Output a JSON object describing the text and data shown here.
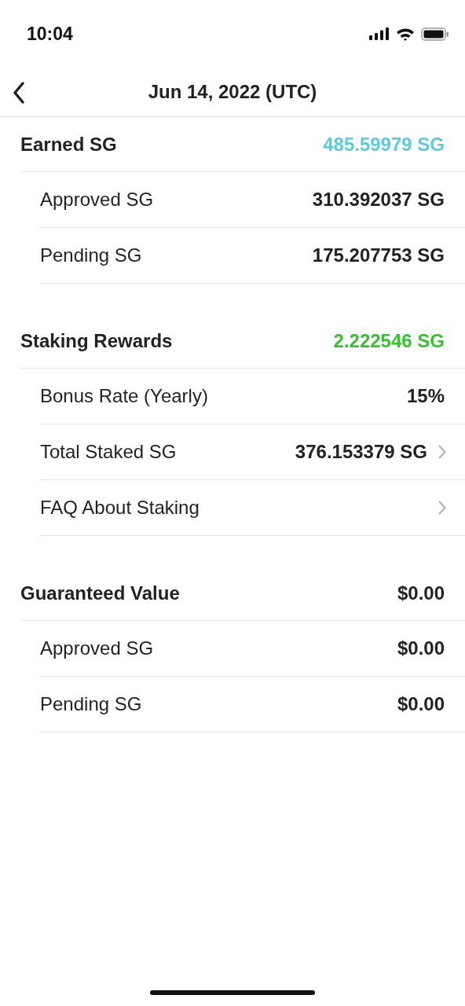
{
  "status_bar": {
    "time": "10:04"
  },
  "nav": {
    "title": "Jun 14, 2022 (UTC)"
  },
  "sections": [
    {
      "title": "Earned SG",
      "value": "485.59979 SG",
      "color": "#58cbdc",
      "rows": [
        {
          "label": "Approved SG",
          "value": "310.392037 SG",
          "chevron": false
        },
        {
          "label": "Pending SG",
          "value": "175.207753 SG",
          "chevron": false
        }
      ]
    },
    {
      "title": "Staking Rewards",
      "value": "2.222546 SG",
      "color": "#35c42f",
      "rows": [
        {
          "label": "Bonus Rate (Yearly)",
          "value": "15%",
          "chevron": false
        },
        {
          "label": "Total Staked SG",
          "value": "376.153379 SG",
          "chevron": true
        },
        {
          "label": "FAQ About Staking",
          "chevron": true
        }
      ]
    },
    {
      "title": "Guaranteed Value",
      "value": "$0.00",
      "color": "#222222",
      "rows": [
        {
          "label": "Approved SG",
          "value": "$0.00",
          "chevron": false
        },
        {
          "label": "Pending SG",
          "value": "$0.00",
          "chevron": false
        }
      ]
    }
  ]
}
